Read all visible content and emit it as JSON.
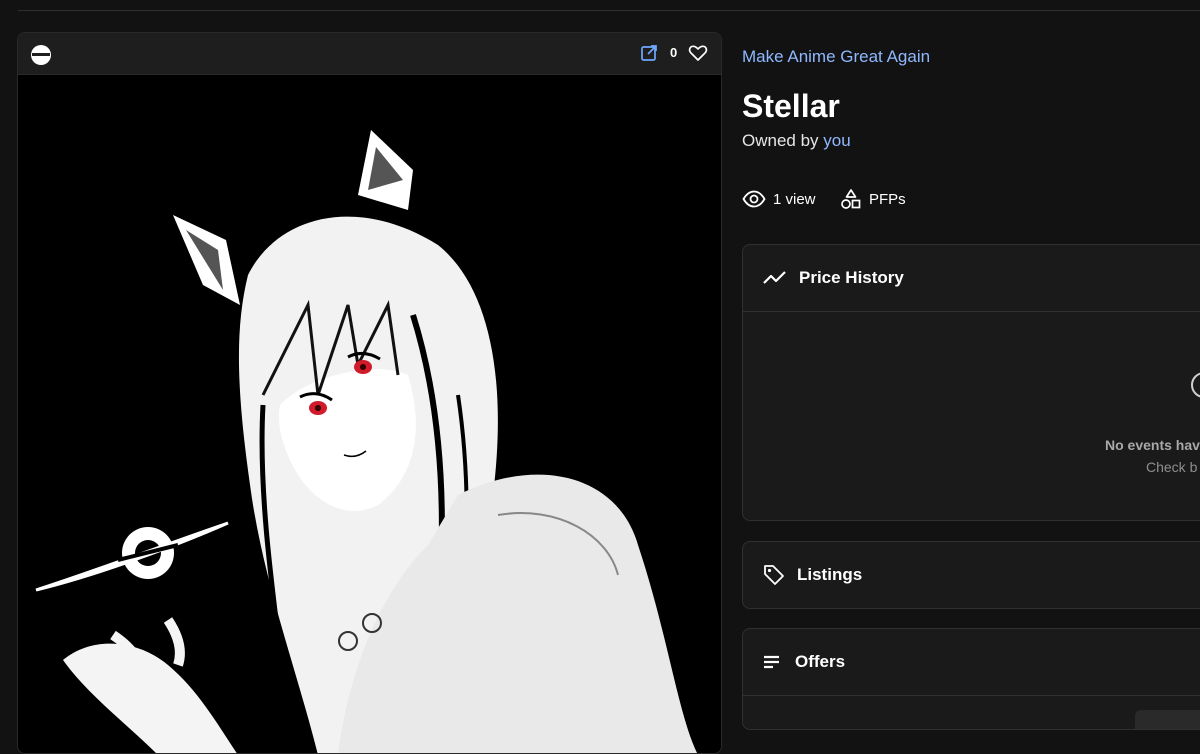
{
  "card": {
    "favorite_count": "0",
    "icons": {
      "chain": "ethereum-logo-icon",
      "external": "external-link-icon",
      "favorite": "heart-icon"
    }
  },
  "collection": {
    "name": "Make Anime Great Again"
  },
  "item": {
    "title": "Stellar",
    "owned_prefix": "Owned by",
    "owner": "you"
  },
  "stats": {
    "views": "1 view",
    "category": "PFPs",
    "icons": {
      "views": "eye-icon",
      "category": "shapes-icon"
    }
  },
  "panels": {
    "price_history": {
      "title": "Price History",
      "empty_title": "No events hav",
      "empty_subtitle": "Check b"
    },
    "listings": {
      "title": "Listings"
    },
    "offers": {
      "title": "Offers"
    }
  },
  "colors": {
    "background": "#121212",
    "link": "#8fb8ff",
    "panel": "#1a1a1a"
  }
}
